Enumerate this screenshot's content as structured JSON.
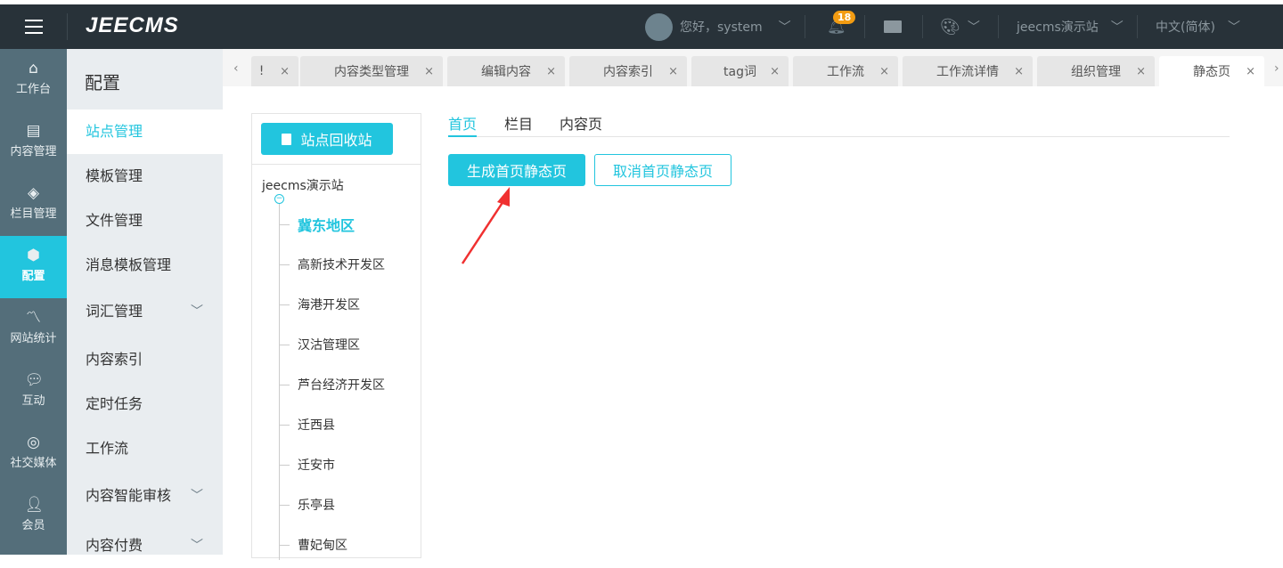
{
  "header": {
    "logo": "JEECMS",
    "greeting": "您好，system",
    "notifications": "18",
    "site": "jeecms演示站",
    "language": "中文(简体)"
  },
  "iconbar": [
    {
      "label": "工作台",
      "icon": "home-icon"
    },
    {
      "label": "内容管理",
      "icon": "document-icon"
    },
    {
      "label": "栏目管理",
      "icon": "layers-icon"
    },
    {
      "label": "配置",
      "icon": "box-icon"
    },
    {
      "label": "网站统计",
      "icon": "chart-icon"
    },
    {
      "label": "互动",
      "icon": "chat-icon"
    },
    {
      "label": "社交媒体",
      "icon": "social-icon"
    },
    {
      "label": "会员",
      "icon": "user-icon"
    }
  ],
  "menu": {
    "title": "配置",
    "items": [
      {
        "label": "站点管理"
      },
      {
        "label": "模板管理"
      },
      {
        "label": "文件管理"
      },
      {
        "label": "消息模板管理"
      },
      {
        "label": "词汇管理",
        "expandable": true
      },
      {
        "label": "内容索引"
      },
      {
        "label": "定时任务"
      },
      {
        "label": "工作流"
      },
      {
        "label": "内容智能审核",
        "expandable": true
      },
      {
        "label": "内容付费",
        "expandable": true
      }
    ]
  },
  "tabs": [
    {
      "label": "!"
    },
    {
      "label": "内容类型管理"
    },
    {
      "label": "编辑内容"
    },
    {
      "label": "内容索引"
    },
    {
      "label": "tag词"
    },
    {
      "label": "工作流"
    },
    {
      "label": "工作流详情"
    },
    {
      "label": "组织管理"
    },
    {
      "label": "静态页"
    }
  ],
  "tree": {
    "recycle_label": "站点回收站",
    "root": "jeecms演示站",
    "nodes": [
      "冀东地区",
      "高新技术开发区",
      "海港开发区",
      "汉沽管理区",
      "芦台经济开发区",
      "迁西县",
      "迁安市",
      "乐亭县",
      "曹妃甸区"
    ]
  },
  "content": {
    "tabs": [
      "首页",
      "栏目",
      "内容页"
    ],
    "generate_label": "生成首页静态页",
    "cancel_label": "取消首页静态页"
  },
  "colors": {
    "accent": "#22c5de",
    "header": "#283239",
    "iconbar": "#546e7a",
    "arrow": "#f03030"
  }
}
